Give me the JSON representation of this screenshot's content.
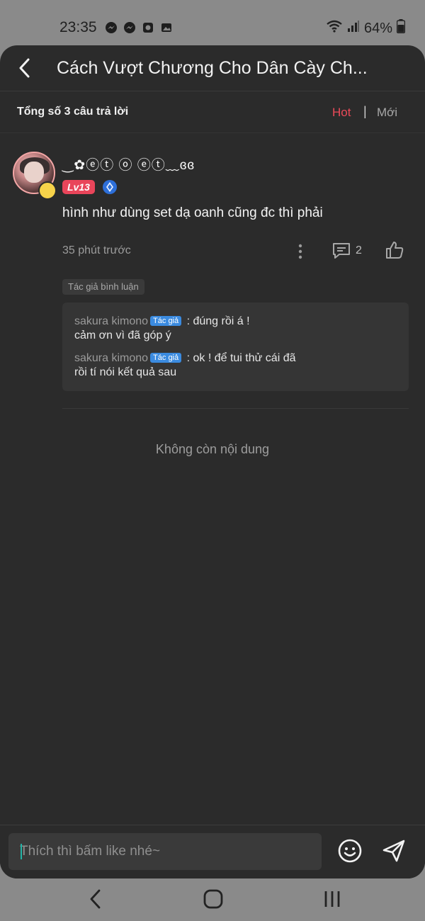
{
  "status_bar": {
    "time": "23:35",
    "battery": "64%",
    "left_icons": [
      "messenger-icon",
      "messenger-icon",
      "app-notification-icon",
      "image-icon"
    ],
    "right_icons": [
      "wifi-icon",
      "signal-icon",
      "battery-icon"
    ]
  },
  "header": {
    "title": "Cách Vượt Chương Cho Dân Cày Ch...",
    "back_icon": "chevron-left-icon"
  },
  "sort_bar": {
    "total": "Tổng số 3 câu trả lời",
    "hot": "Hot",
    "separator": "|",
    "new": "Mới",
    "active_color": "#ec4a59"
  },
  "comment": {
    "username": "‿✿ⓔⓣ ⓞ ⓔⓣ﹏ɞɞ",
    "level": "Lv13",
    "text": "hình như dùng set dạ oanh cũng đc thì phải",
    "time": "35 phút trước",
    "reply_count": "2",
    "author_tag": "Tác giả bình luận",
    "replies": [
      {
        "name": "sakura kimono",
        "tag": "Tác giả",
        "sep": " : ",
        "text": "đúng rồi á !",
        "text2": "cảm ơn vì đã góp ý"
      },
      {
        "name": "sakura kimono",
        "tag": "Tác giả",
        "sep": " : ",
        "text": "ok ! để tui thử cái đã",
        "text2": "rồi tí nói kết quả sau"
      }
    ]
  },
  "no_more": "Không còn nội dung",
  "input": {
    "placeholder": "Thích thì bấm like nhé~"
  },
  "colors": {
    "background": "#2b2b2b",
    "accent": "#ec4a59",
    "author_tag": "#3b8be0"
  }
}
